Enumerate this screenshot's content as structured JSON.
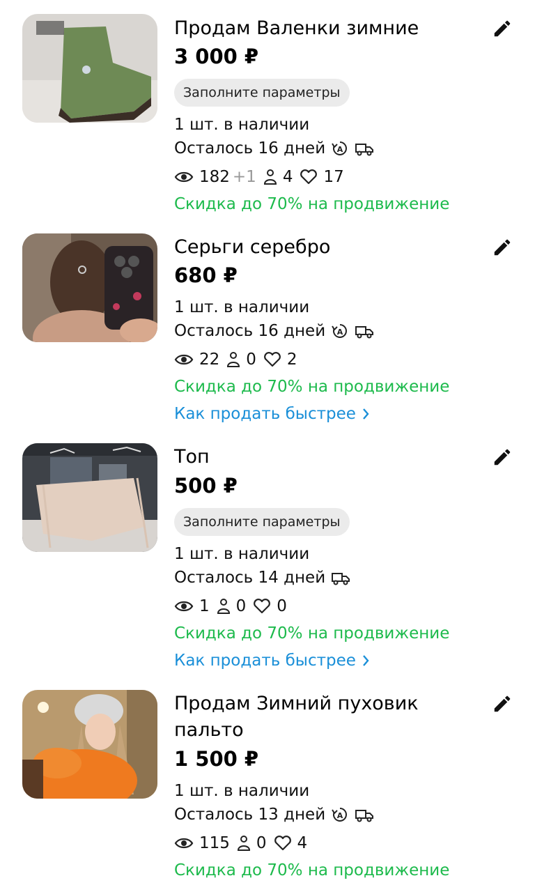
{
  "listings": [
    {
      "title": "Продам Валенки зимние",
      "price": "3 000 ₽",
      "chip": "Заполните параметры",
      "stock": "1 шт. в наличии",
      "days_left": "Осталось 16 дней",
      "auto_renew": true,
      "delivery": true,
      "views": "182",
      "views_delta": "+1",
      "contacts": "4",
      "favorites": "17",
      "promo": "Скидка до 70% на продвижение",
      "howto": "",
      "photo": "green felt boots"
    },
    {
      "title": "Серьги серебро",
      "price": "680 ₽",
      "chip": "",
      "stock": "1 шт. в наличии",
      "days_left": "Осталось 16 дней",
      "auto_renew": true,
      "delivery": true,
      "views": "22",
      "views_delta": "",
      "contacts": "0",
      "favorites": "2",
      "promo": "Скидка до 70% на продвижение",
      "howto": "Как продать быстрее",
      "photo": "mirror selfie with earrings"
    },
    {
      "title": "Топ",
      "price": "500 ₽",
      "chip": "Заполните параметры",
      "stock": "1 шт. в наличии",
      "days_left": "Осталось 14 дней",
      "auto_renew": false,
      "delivery": true,
      "views": "1",
      "views_delta": "",
      "contacts": "0",
      "favorites": "0",
      "promo": "Скидка до 70% на продвижение",
      "howto": "Как продать быстрее",
      "photo": "beige top on hanger"
    },
    {
      "title": "Продам Зимний пуховик пальто",
      "price": "1 500 ₽",
      "chip": "",
      "stock": "1 шт. в наличии",
      "days_left": "Осталось 13 дней",
      "auto_renew": true,
      "delivery": true,
      "views": "115",
      "views_delta": "",
      "contacts": "0",
      "favorites": "4",
      "promo": "Скидка до 70% на продвижение",
      "howto": "",
      "photo": "orange puffer coat selfie"
    }
  ],
  "colors": {
    "promo": "#1dba4c",
    "link": "#1a8fd8",
    "chip_bg": "#ebebeb"
  },
  "icons": [
    "edit-icon",
    "eye-icon",
    "person-icon",
    "heart-icon",
    "auto-renew-icon",
    "delivery-truck-icon",
    "chevron-right-icon"
  ]
}
